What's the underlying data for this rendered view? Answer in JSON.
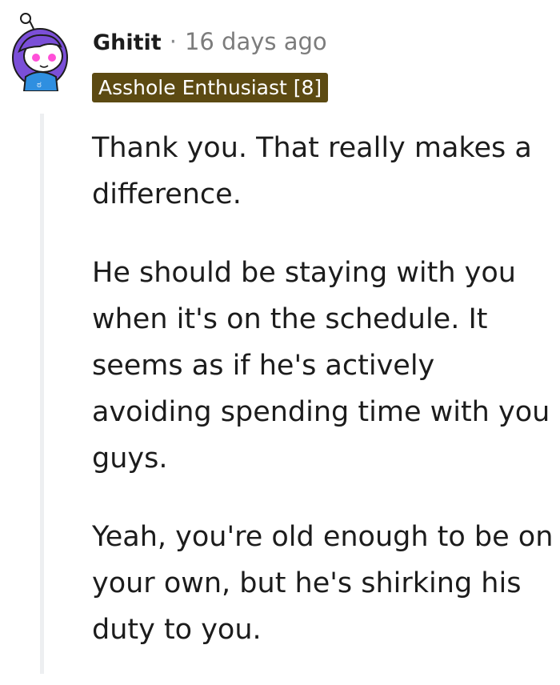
{
  "comment": {
    "username": "Ghitit",
    "separator": "·",
    "timestamp": "16 days ago",
    "flair": "Asshole Enthusiast [8]",
    "paragraphs": [
      "Thank you. That really makes a difference.",
      "He should be staying with you when it's on the schedule. It seems as if he's actively avoiding spending time with you guys.",
      "Yeah, you're old enough to be on your own, but he's shirking his duty to you."
    ]
  },
  "colors": {
    "flair_background": "#5c4a12",
    "avatar_hair": "#7b4fd8",
    "avatar_shirt": "#2f8fe0",
    "thread_line": "#edeff1"
  },
  "icons": {
    "avatar": "snoo-avatar-icon"
  }
}
